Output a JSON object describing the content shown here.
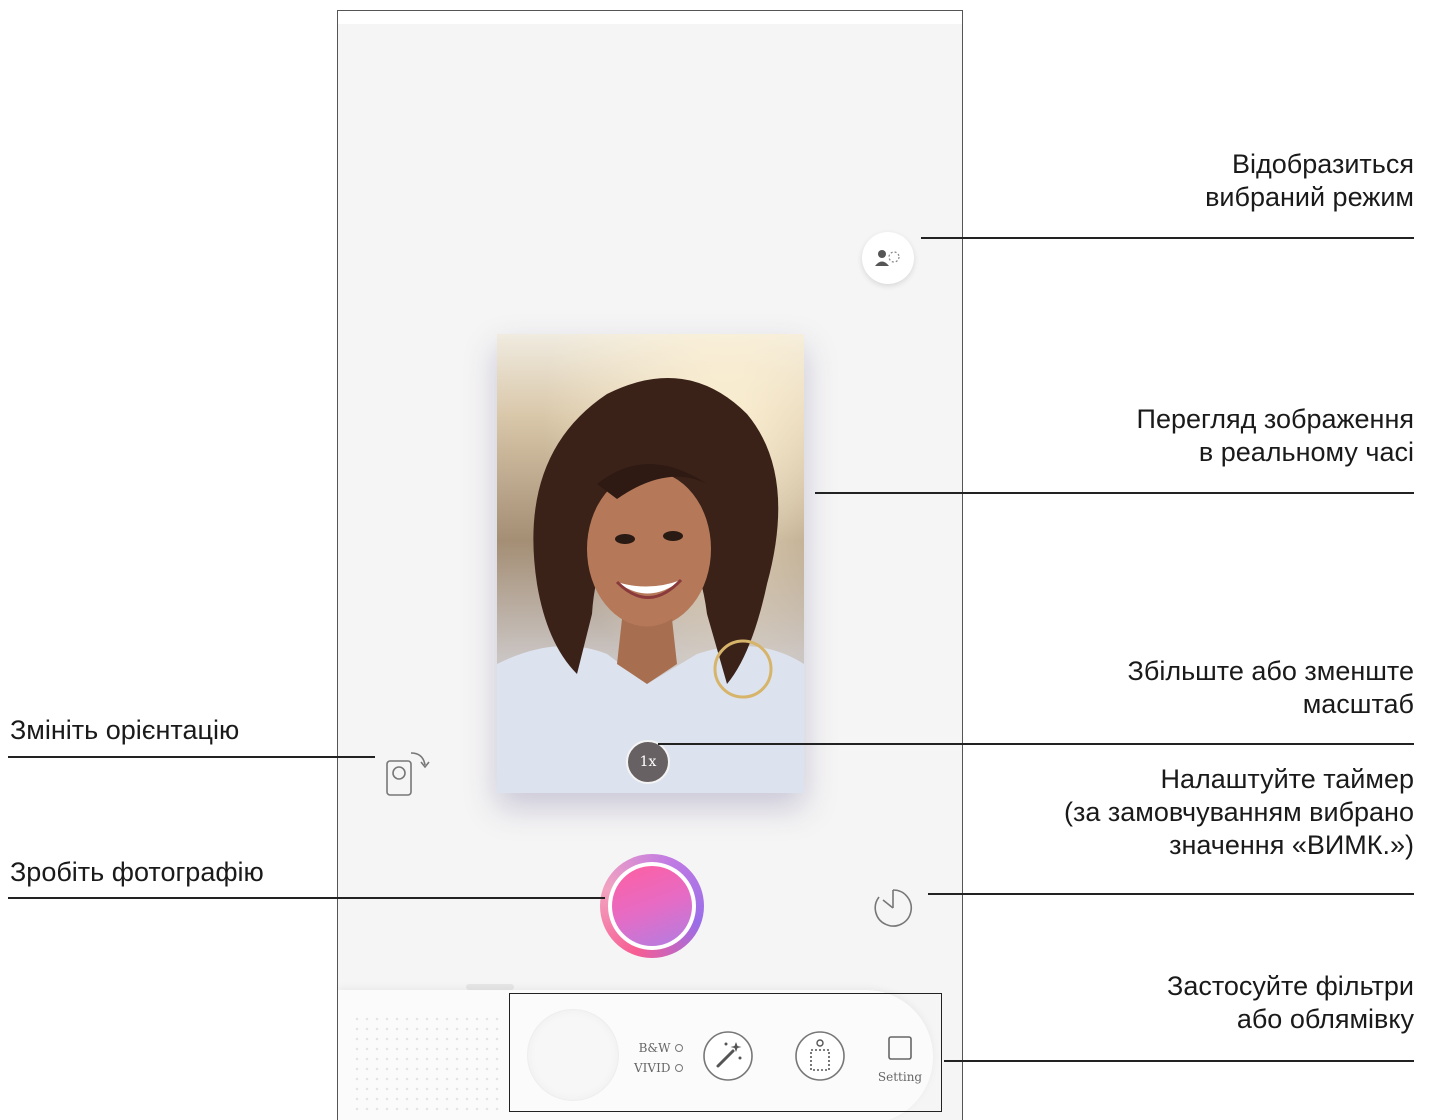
{
  "screen": {
    "zoom_level": "1x",
    "filter_options": [
      "B&W",
      "VIVID"
    ],
    "setting_label": "Setting",
    "icons": [
      "mode-indicator-icon",
      "orientation-rotate-icon",
      "timer-icon",
      "magic-wand-icon",
      "frame-icon",
      "setting-frame-icon"
    ]
  },
  "callouts": {
    "mode": [
      "Відобразиться",
      "вибраний режим"
    ],
    "live_view": [
      "Перегляд зображення",
      "в реальному часі"
    ],
    "zoom": [
      "Збільште або зменште",
      "масштаб"
    ],
    "orientation": "Змініть орієнтацію",
    "timer": [
      "Налаштуйте таймер",
      "(за замовчуванням вибрано",
      "значення «ВИМК.»)"
    ],
    "shutter": "Зробіть фотографію",
    "filters": [
      "Застосуйте фільтри",
      "або облямівку"
    ]
  },
  "colors": {
    "shutter_gradient": [
      "#ff5fa0",
      "#b17ee3"
    ],
    "screen_background": "#f5f5f5"
  }
}
